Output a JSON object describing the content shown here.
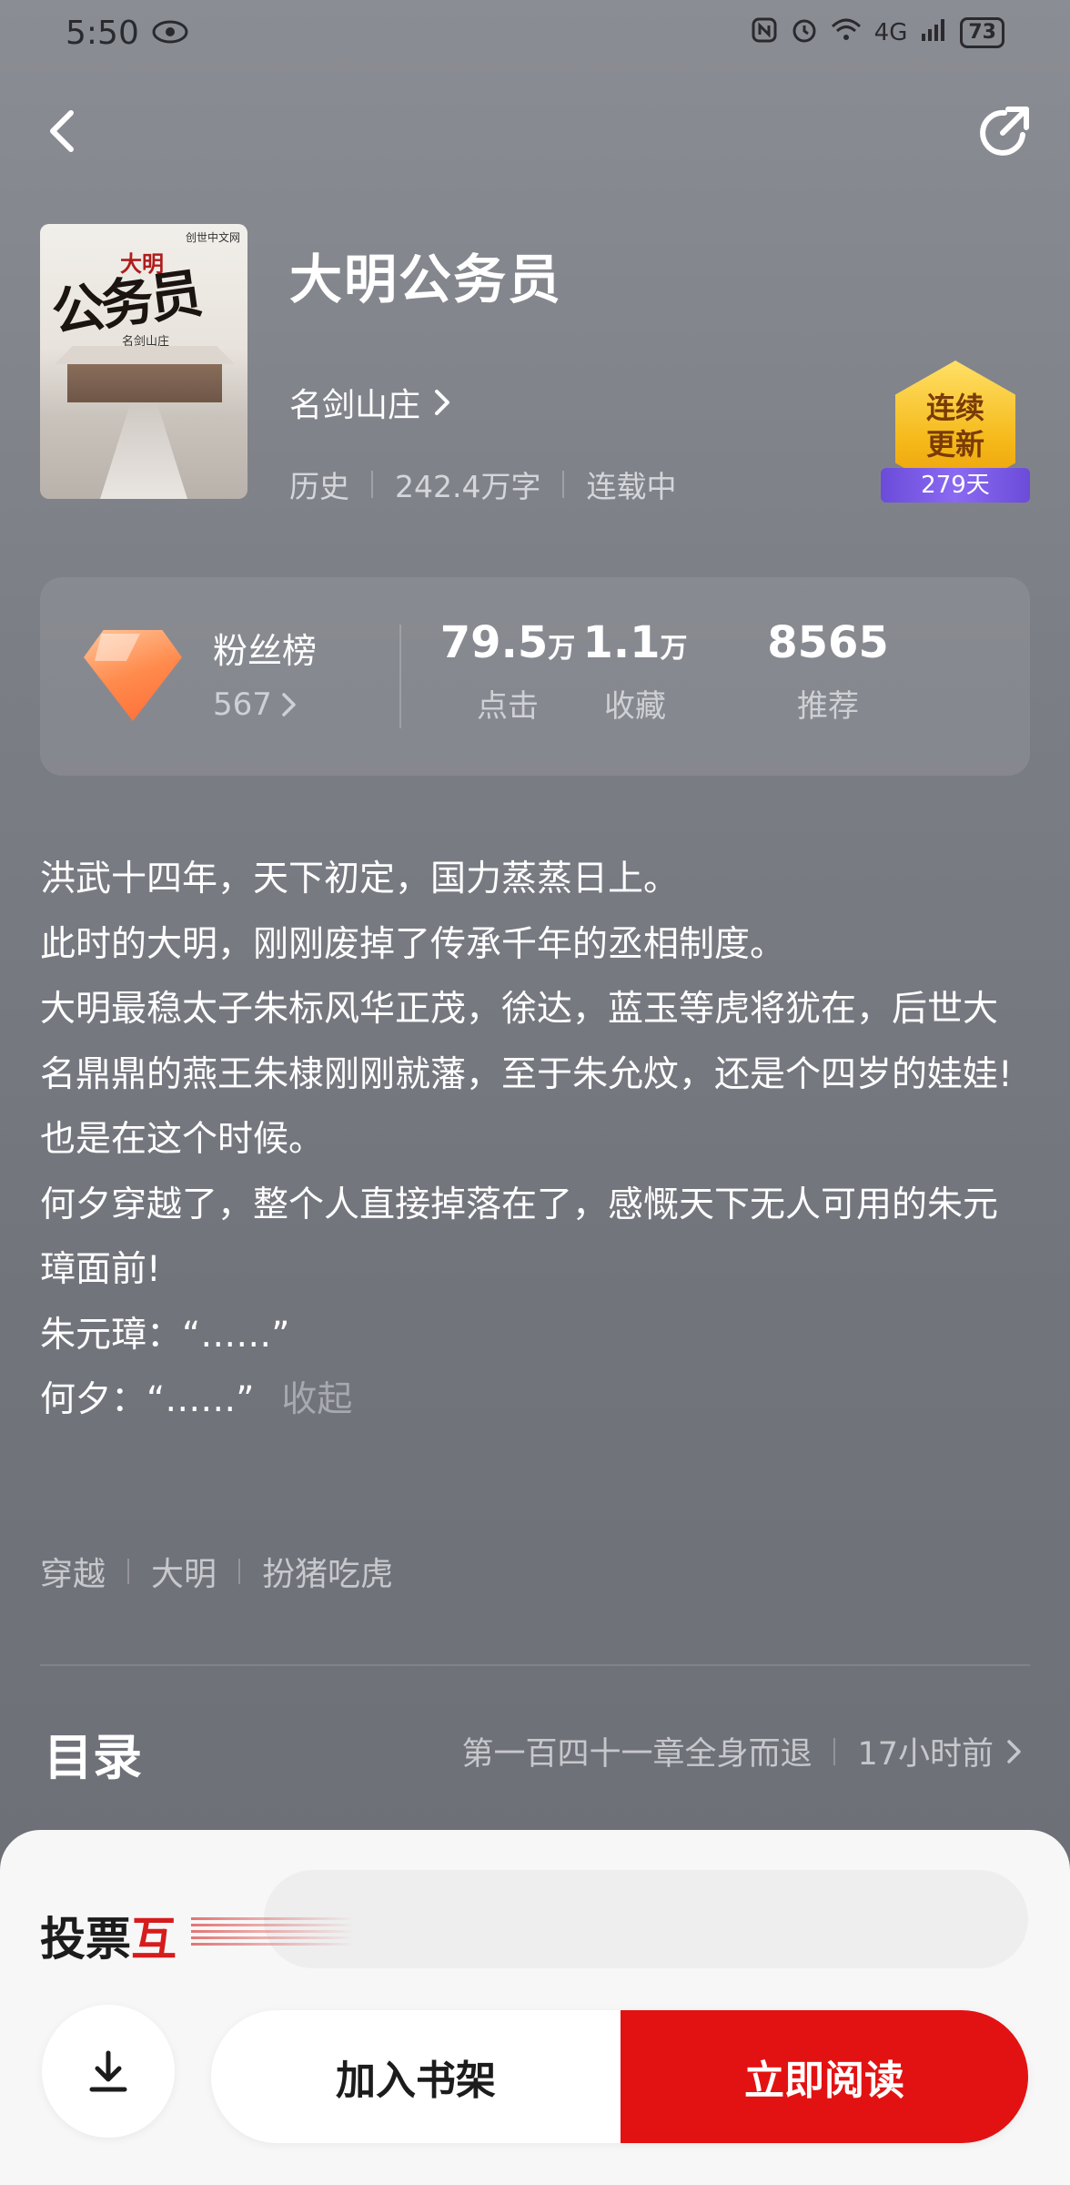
{
  "status_bar": {
    "time": "5:50",
    "network": "4G",
    "battery": "73"
  },
  "book": {
    "title": "大明公务员",
    "author": "名剑山庄",
    "category": "历史",
    "word_count": "242.4万字",
    "status": "连载中",
    "cover": {
      "title_text": "公务员",
      "title_small": "大明",
      "publisher": "创世中文网",
      "author_text": "名剑山庄"
    },
    "badge": {
      "line1": "连续",
      "line2": "更新",
      "days": "279天"
    }
  },
  "stats": {
    "fans_label": "粉丝榜",
    "fans_rank": "567",
    "clicks": {
      "value": "79.5",
      "unit": "万",
      "label": "点击"
    },
    "favorites": {
      "value": "1.1",
      "unit": "万",
      "label": "收藏"
    },
    "recommends": {
      "value": "8565",
      "label": "推荐"
    }
  },
  "synopsis": {
    "lines": [
      "洪武十四年，天下初定，国力蒸蒸日上。",
      "此时的大明，刚刚废掉了传承千年的丞相制度。",
      "大明最稳太子朱标风华正茂，徐达，蓝玉等虎将犹在，后世大名鼎鼎的燕王朱棣刚刚就藩，至于朱允炆，还是个四岁的娃娃!",
      "也是在这个时候。",
      "何夕穿越了，整个人直接掉落在了，感慨天下无人可用的朱元璋面前!",
      "朱元璋：“……”",
      "何夕：“……”"
    ],
    "collapse_label": "收起"
  },
  "tags": [
    "穿越",
    "大明",
    "扮猪吃虎"
  ],
  "toc": {
    "title": "目录",
    "latest_chapter": "第一百四十一章全身而退",
    "updated": "17小时前"
  },
  "vote": {
    "label_a": "投票",
    "label_b": "互"
  },
  "actions": {
    "add_to_shelf": "加入书架",
    "read_now": "立即阅读"
  },
  "colors": {
    "accent_red": "#e31212",
    "badge_gold": "#f5b818",
    "badge_purple": "#6b4cd9",
    "diamond_orange": "#ff8a4c"
  }
}
